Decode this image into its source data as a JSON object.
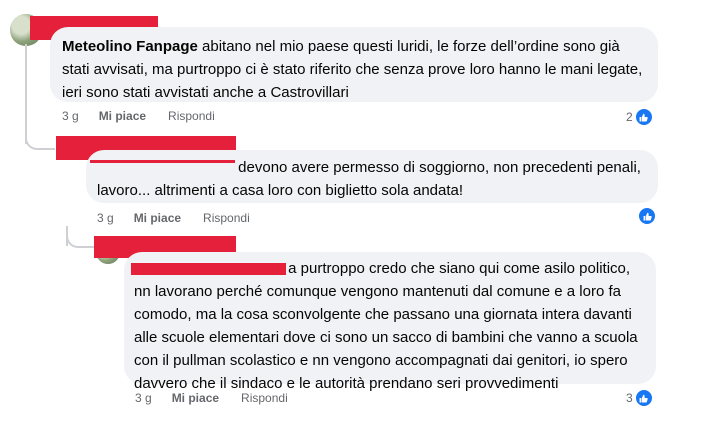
{
  "comments": [
    {
      "author": "Meteolino Fanpage",
      "text": " abitano nel mio paese questi luridi, le forze dell'ordine sono già stati avvisati, ma purtroppo ci è stato riferito che senza prove loro hanno le mani legate, ieri sono stati avvistati anche a Castrovillari",
      "line1": "abitano nel mio paese questi luridi, le forze dell’ordine sono già",
      "line2": "stati avvisati, ma purtroppo ci è stato riferito che senza prove loro hanno le mani legate,",
      "line3": "ieri sono stati avvistati anche a Castrovillari",
      "time": "3 g",
      "like_label": "Mi piace",
      "reply_label": "Rispondi",
      "reactions_count": "2"
    },
    {
      "line1": "devono avere permesso di soggiorno, non precedenti penali,",
      "line2": "lavoro... altrimenti a casa loro con biglietto sola andata!",
      "time": "3 g",
      "like_label": "Mi piace",
      "reply_label": "Rispondi",
      "reactions_count": ""
    },
    {
      "line1": "a purtroppo credo che siano qui come asilo politico,",
      "line2": "nn lavorano perché comunque vengono mantenuti dal comune e a loro fa",
      "line3": "comodo, ma la cosa sconvolgente che passano una giornata intera davanti",
      "line4": "alle scuole elementari dove ci sono un sacco di bambini che vanno a scuola",
      "line5": "con il pullman scolastico e nn vengono accompagnati dai genitori, io spero",
      "line6": "davvero che il sindaco e le autorità prendano seri provvedimenti",
      "time": "3 g",
      "like_label": "Mi piace",
      "reply_label": "Rispondi",
      "reactions_count": "3"
    }
  ],
  "colors": {
    "bubble": "#f0f2f5",
    "redaction": "#e5203a",
    "like_blue": "#1877f2",
    "meta_gray": "#65676b"
  },
  "icons": [
    "like-icon",
    "avatar"
  ]
}
